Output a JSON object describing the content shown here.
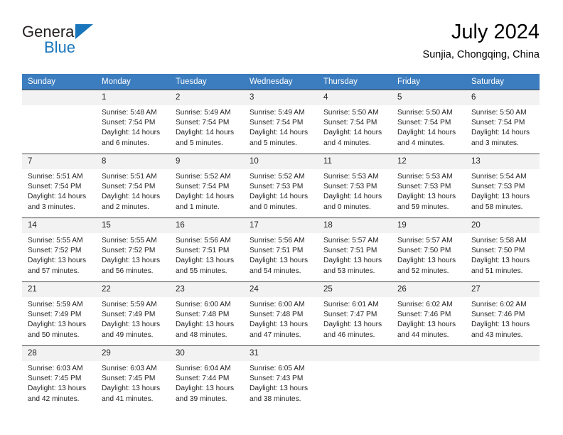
{
  "brand": {
    "line1": "General",
    "line2": "Blue",
    "triangle_color": "#1a76bc"
  },
  "header": {
    "title": "July 2024",
    "subtitle": "Sunjia, Chongqing, China"
  },
  "theme": {
    "header_row_bg": "#3c7dbf",
    "header_row_text": "#ffffff",
    "daynum_bg": "#f2f2f2",
    "row_border": "#4a4a4a"
  },
  "weekdays": [
    "Sunday",
    "Monday",
    "Tuesday",
    "Wednesday",
    "Thursday",
    "Friday",
    "Saturday"
  ],
  "weeks": [
    [
      {
        "day": "",
        "sunrise": "",
        "sunset": "",
        "daylight1": "",
        "daylight2": ""
      },
      {
        "day": "1",
        "sunrise": "Sunrise: 5:48 AM",
        "sunset": "Sunset: 7:54 PM",
        "daylight1": "Daylight: 14 hours",
        "daylight2": "and 6 minutes."
      },
      {
        "day": "2",
        "sunrise": "Sunrise: 5:49 AM",
        "sunset": "Sunset: 7:54 PM",
        "daylight1": "Daylight: 14 hours",
        "daylight2": "and 5 minutes."
      },
      {
        "day": "3",
        "sunrise": "Sunrise: 5:49 AM",
        "sunset": "Sunset: 7:54 PM",
        "daylight1": "Daylight: 14 hours",
        "daylight2": "and 5 minutes."
      },
      {
        "day": "4",
        "sunrise": "Sunrise: 5:50 AM",
        "sunset": "Sunset: 7:54 PM",
        "daylight1": "Daylight: 14 hours",
        "daylight2": "and 4 minutes."
      },
      {
        "day": "5",
        "sunrise": "Sunrise: 5:50 AM",
        "sunset": "Sunset: 7:54 PM",
        "daylight1": "Daylight: 14 hours",
        "daylight2": "and 4 minutes."
      },
      {
        "day": "6",
        "sunrise": "Sunrise: 5:50 AM",
        "sunset": "Sunset: 7:54 PM",
        "daylight1": "Daylight: 14 hours",
        "daylight2": "and 3 minutes."
      }
    ],
    [
      {
        "day": "7",
        "sunrise": "Sunrise: 5:51 AM",
        "sunset": "Sunset: 7:54 PM",
        "daylight1": "Daylight: 14 hours",
        "daylight2": "and 3 minutes."
      },
      {
        "day": "8",
        "sunrise": "Sunrise: 5:51 AM",
        "sunset": "Sunset: 7:54 PM",
        "daylight1": "Daylight: 14 hours",
        "daylight2": "and 2 minutes."
      },
      {
        "day": "9",
        "sunrise": "Sunrise: 5:52 AM",
        "sunset": "Sunset: 7:54 PM",
        "daylight1": "Daylight: 14 hours",
        "daylight2": "and 1 minute."
      },
      {
        "day": "10",
        "sunrise": "Sunrise: 5:52 AM",
        "sunset": "Sunset: 7:53 PM",
        "daylight1": "Daylight: 14 hours",
        "daylight2": "and 0 minutes."
      },
      {
        "day": "11",
        "sunrise": "Sunrise: 5:53 AM",
        "sunset": "Sunset: 7:53 PM",
        "daylight1": "Daylight: 14 hours",
        "daylight2": "and 0 minutes."
      },
      {
        "day": "12",
        "sunrise": "Sunrise: 5:53 AM",
        "sunset": "Sunset: 7:53 PM",
        "daylight1": "Daylight: 13 hours",
        "daylight2": "and 59 minutes."
      },
      {
        "day": "13",
        "sunrise": "Sunrise: 5:54 AM",
        "sunset": "Sunset: 7:53 PM",
        "daylight1": "Daylight: 13 hours",
        "daylight2": "and 58 minutes."
      }
    ],
    [
      {
        "day": "14",
        "sunrise": "Sunrise: 5:55 AM",
        "sunset": "Sunset: 7:52 PM",
        "daylight1": "Daylight: 13 hours",
        "daylight2": "and 57 minutes."
      },
      {
        "day": "15",
        "sunrise": "Sunrise: 5:55 AM",
        "sunset": "Sunset: 7:52 PM",
        "daylight1": "Daylight: 13 hours",
        "daylight2": "and 56 minutes."
      },
      {
        "day": "16",
        "sunrise": "Sunrise: 5:56 AM",
        "sunset": "Sunset: 7:51 PM",
        "daylight1": "Daylight: 13 hours",
        "daylight2": "and 55 minutes."
      },
      {
        "day": "17",
        "sunrise": "Sunrise: 5:56 AM",
        "sunset": "Sunset: 7:51 PM",
        "daylight1": "Daylight: 13 hours",
        "daylight2": "and 54 minutes."
      },
      {
        "day": "18",
        "sunrise": "Sunrise: 5:57 AM",
        "sunset": "Sunset: 7:51 PM",
        "daylight1": "Daylight: 13 hours",
        "daylight2": "and 53 minutes."
      },
      {
        "day": "19",
        "sunrise": "Sunrise: 5:57 AM",
        "sunset": "Sunset: 7:50 PM",
        "daylight1": "Daylight: 13 hours",
        "daylight2": "and 52 minutes."
      },
      {
        "day": "20",
        "sunrise": "Sunrise: 5:58 AM",
        "sunset": "Sunset: 7:50 PM",
        "daylight1": "Daylight: 13 hours",
        "daylight2": "and 51 minutes."
      }
    ],
    [
      {
        "day": "21",
        "sunrise": "Sunrise: 5:59 AM",
        "sunset": "Sunset: 7:49 PM",
        "daylight1": "Daylight: 13 hours",
        "daylight2": "and 50 minutes."
      },
      {
        "day": "22",
        "sunrise": "Sunrise: 5:59 AM",
        "sunset": "Sunset: 7:49 PM",
        "daylight1": "Daylight: 13 hours",
        "daylight2": "and 49 minutes."
      },
      {
        "day": "23",
        "sunrise": "Sunrise: 6:00 AM",
        "sunset": "Sunset: 7:48 PM",
        "daylight1": "Daylight: 13 hours",
        "daylight2": "and 48 minutes."
      },
      {
        "day": "24",
        "sunrise": "Sunrise: 6:00 AM",
        "sunset": "Sunset: 7:48 PM",
        "daylight1": "Daylight: 13 hours",
        "daylight2": "and 47 minutes."
      },
      {
        "day": "25",
        "sunrise": "Sunrise: 6:01 AM",
        "sunset": "Sunset: 7:47 PM",
        "daylight1": "Daylight: 13 hours",
        "daylight2": "and 46 minutes."
      },
      {
        "day": "26",
        "sunrise": "Sunrise: 6:02 AM",
        "sunset": "Sunset: 7:46 PM",
        "daylight1": "Daylight: 13 hours",
        "daylight2": "and 44 minutes."
      },
      {
        "day": "27",
        "sunrise": "Sunrise: 6:02 AM",
        "sunset": "Sunset: 7:46 PM",
        "daylight1": "Daylight: 13 hours",
        "daylight2": "and 43 minutes."
      }
    ],
    [
      {
        "day": "28",
        "sunrise": "Sunrise: 6:03 AM",
        "sunset": "Sunset: 7:45 PM",
        "daylight1": "Daylight: 13 hours",
        "daylight2": "and 42 minutes."
      },
      {
        "day": "29",
        "sunrise": "Sunrise: 6:03 AM",
        "sunset": "Sunset: 7:45 PM",
        "daylight1": "Daylight: 13 hours",
        "daylight2": "and 41 minutes."
      },
      {
        "day": "30",
        "sunrise": "Sunrise: 6:04 AM",
        "sunset": "Sunset: 7:44 PM",
        "daylight1": "Daylight: 13 hours",
        "daylight2": "and 39 minutes."
      },
      {
        "day": "31",
        "sunrise": "Sunrise: 6:05 AM",
        "sunset": "Sunset: 7:43 PM",
        "daylight1": "Daylight: 13 hours",
        "daylight2": "and 38 minutes."
      },
      {
        "day": "",
        "sunrise": "",
        "sunset": "",
        "daylight1": "",
        "daylight2": ""
      },
      {
        "day": "",
        "sunrise": "",
        "sunset": "",
        "daylight1": "",
        "daylight2": ""
      },
      {
        "day": "",
        "sunrise": "",
        "sunset": "",
        "daylight1": "",
        "daylight2": ""
      }
    ]
  ]
}
